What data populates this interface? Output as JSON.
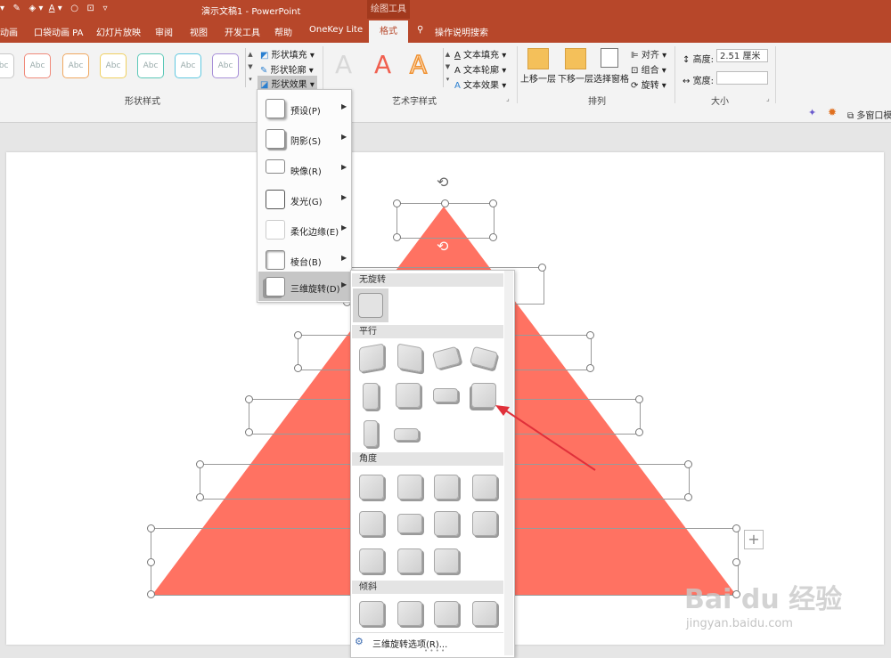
{
  "titlebar": {
    "document_title": "演示文稿1  -  PowerPoint",
    "context_tab_group": "绘图工具"
  },
  "tabs": [
    "动画",
    "口袋动画 PA",
    "幻灯片放映",
    "审阅",
    "视图",
    "开发工具",
    "帮助",
    "OneKey Lite",
    "格式"
  ],
  "tell_me": "操作说明搜索",
  "ribbon": {
    "shape_style_sample": "Abc",
    "shape_fill": "形状填充",
    "shape_outline": "形状轮廓",
    "shape_effects": "形状效果",
    "group_shape_styles": "形状样式",
    "text_fill": "文本填充",
    "text_outline": "文本轮廓",
    "text_effects": "文本效果",
    "group_wordart": "艺术字样式",
    "wordart_sample": "A",
    "bring_forward": "上移一层",
    "send_backward": "下移一层",
    "selection_pane": "选择窗格",
    "align": "对齐",
    "group": "组合",
    "rotate": "旋转",
    "group_arrange": "排列",
    "height_label": "高度:",
    "height_value": "2.51 厘米",
    "width_label": "宽度:",
    "width_value": "",
    "group_size": "大小"
  },
  "quickbar": {
    "multi_window": "多窗口模"
  },
  "effects_menu": [
    {
      "label": "预设(P)"
    },
    {
      "label": "阴影(S)"
    },
    {
      "label": "映像(R)"
    },
    {
      "label": "发光(G)"
    },
    {
      "label": "柔化边缘(E)"
    },
    {
      "label": "棱台(B)"
    },
    {
      "label": "三维旋转(D)"
    }
  ],
  "gallery": {
    "sections": [
      "无旋转",
      "平行",
      "角度",
      "倾斜"
    ],
    "footer": "三维旋转选项(R)...",
    "selected_section": "平行",
    "highlighted_item": "平行 row 2, item 4"
  },
  "watermark": {
    "brand": "Bai du 经验",
    "url": "jingyan.baidu.com"
  },
  "colors": {
    "accent": "#b7472a",
    "triangle": "#ff7262",
    "highlight": "#e6e6e6",
    "arrow": "#e0303a"
  }
}
